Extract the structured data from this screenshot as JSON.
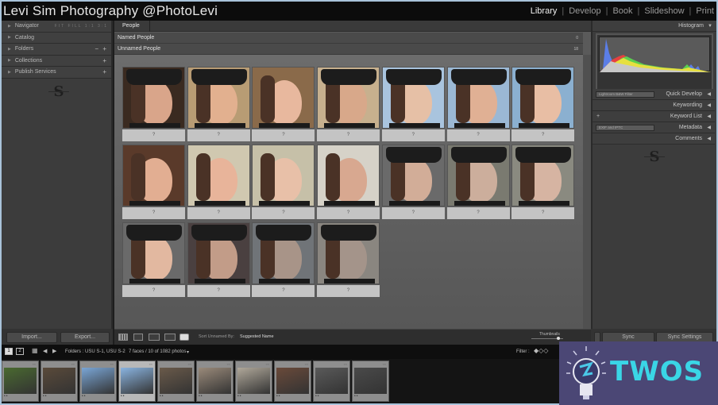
{
  "window": {
    "title": "Levi Sim Photography @PhotoLevi",
    "modules": [
      {
        "label": "Library",
        "active": true
      },
      {
        "label": "Develop",
        "active": false
      },
      {
        "label": "Book",
        "active": false
      },
      {
        "label": "Slideshow",
        "active": false
      },
      {
        "label": "Print",
        "active": false
      }
    ]
  },
  "left_panel": {
    "items": [
      {
        "label": "Navigator",
        "icon": "triangle-right-icon"
      },
      {
        "label": "Catalog",
        "icon": "triangle-right-icon"
      },
      {
        "label": "Folders",
        "icon": "triangle-right-icon"
      },
      {
        "label": "Collections",
        "icon": "triangle-right-icon"
      },
      {
        "label": "Publish Services",
        "icon": "triangle-right-icon"
      }
    ],
    "navigator_zoom": "FIT  FILL  1:1  3:1",
    "import_label": "Import...",
    "export_label": "Export..."
  },
  "center": {
    "tab": "People",
    "sections": [
      {
        "label": "Named People",
        "count": "0"
      },
      {
        "label": "Unnamed People",
        "count": "18"
      }
    ],
    "face_label": "?",
    "faces": [
      {
        "bg": "#3a2a20",
        "skin": "#d9a58a",
        "cap": true
      },
      {
        "bg": "#b89c74",
        "skin": "#e2b08f",
        "cap": true
      },
      {
        "bg": "#8a6a4a",
        "skin": "#e8b89e",
        "cap": false
      },
      {
        "bg": "#c7b08e",
        "skin": "#d8a88a",
        "cap": true
      },
      {
        "bg": "#a9c4de",
        "skin": "#e6c0a6",
        "cap": true
      },
      {
        "bg": "#9bb8d4",
        "skin": "#e0b094",
        "cap": true
      },
      {
        "bg": "#8bb0d0",
        "skin": "#e8bea4",
        "cap": true
      },
      {
        "bg": "#5a3a2a",
        "skin": "#e2ae92",
        "cap": false
      },
      {
        "bg": "#d0c8b0",
        "skin": "#e8b49a",
        "cap": false
      },
      {
        "bg": "#c6c0a8",
        "skin": "#e8c0a8",
        "cap": false
      },
      {
        "bg": "#d6d2c8",
        "skin": "#d8a890",
        "cap": false
      },
      {
        "bg": "#6a6a6a",
        "skin": "#d2ad98",
        "cap": true
      },
      {
        "bg": "#7a7a70",
        "skin": "#ccae9c",
        "cap": true
      },
      {
        "bg": "#8a8a80",
        "skin": "#d6b4a2",
        "cap": true
      },
      {
        "bg": "#6a6a6a",
        "skin": "#e2b8a0",
        "cap": true
      },
      {
        "bg": "#4a4040",
        "skin": "#c29c88",
        "cap": true
      },
      {
        "bg": "#707478",
        "skin": "#a89488",
        "cap": true
      },
      {
        "bg": "#8a8680",
        "skin": "#a4948a",
        "cap": true
      }
    ]
  },
  "toolbar": {
    "sort_label": "Sort Unnamed By:",
    "sort_value": "Suggested Name",
    "thumbnails_label": "Thumbnails"
  },
  "right_panel": {
    "histogram_label": "Histogram",
    "quick_develop_label": "Quick Develop",
    "quick_develop_preset": "Lightroom B&W Filter",
    "keywording_label": "Keywording",
    "keyword_list_label": "Keyword List",
    "metadata_label": "Metadata",
    "metadata_preset": "EXIF and IPTC",
    "comments_label": "Comments",
    "sync_label": "Sync",
    "sync_settings_label": "Sync Settings"
  },
  "filmstrip_bar": {
    "page1": "1",
    "page2": "2",
    "source": "Folders : USU S-1, USU S-2",
    "count": "7 faces / 10 of 1082 photos",
    "filter_label": "Filter :"
  },
  "filmstrip": {
    "thumbs": [
      {
        "bg": "#4a6a30",
        "selected": false
      },
      {
        "bg": "#5a4a3a",
        "selected": false
      },
      {
        "bg": "#7aa6d6",
        "selected": false
      },
      {
        "bg": "#8ab4e0",
        "selected": true
      },
      {
        "bg": "#6a5a4a",
        "selected": false
      },
      {
        "bg": "#9a8a7a",
        "selected": false
      },
      {
        "bg": "#b0a89a",
        "selected": false
      },
      {
        "bg": "#6a4a3a",
        "selected": false
      },
      {
        "bg": "#5a5a5a",
        "selected": false
      },
      {
        "bg": "#4a4a4a",
        "selected": false
      }
    ]
  },
  "watermark": {
    "text": "TWOS"
  }
}
